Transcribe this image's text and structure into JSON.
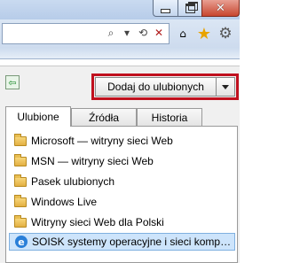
{
  "window": {
    "minimize_glyph": "",
    "close_glyph": "✕"
  },
  "toolbar": {
    "addr_icons": [
      "⌕",
      "▾",
      "⟲",
      "✕"
    ],
    "home_glyph": "⌂",
    "star_glyph": "★",
    "gear_glyph": "⚙"
  },
  "favorites": {
    "pin_glyph": "⇦",
    "add_button_label": "Dodaj do ulubionych",
    "tabs": [
      {
        "label": "Ulubione"
      },
      {
        "label": "Źródła"
      },
      {
        "label": "Historia"
      }
    ],
    "items": [
      {
        "label": "Microsoft — witryny sieci Web",
        "icon": "folder-icon"
      },
      {
        "label": "MSN — witryny sieci Web",
        "icon": "folder-icon"
      },
      {
        "label": "Pasek ulubionych",
        "icon": "folder-icon"
      },
      {
        "label": "Windows Live",
        "icon": "folder-icon"
      },
      {
        "label": "Witryny sieci Web dla Polski",
        "icon": "folder-icon"
      },
      {
        "label": "SOISK systemy operacyjne i sieci komputerowe",
        "icon": "ie-page-icon",
        "ie_glyph": "e"
      }
    ]
  },
  "colors": {
    "highlight_border": "#c0101e",
    "selected_item": "#cde4fb"
  }
}
